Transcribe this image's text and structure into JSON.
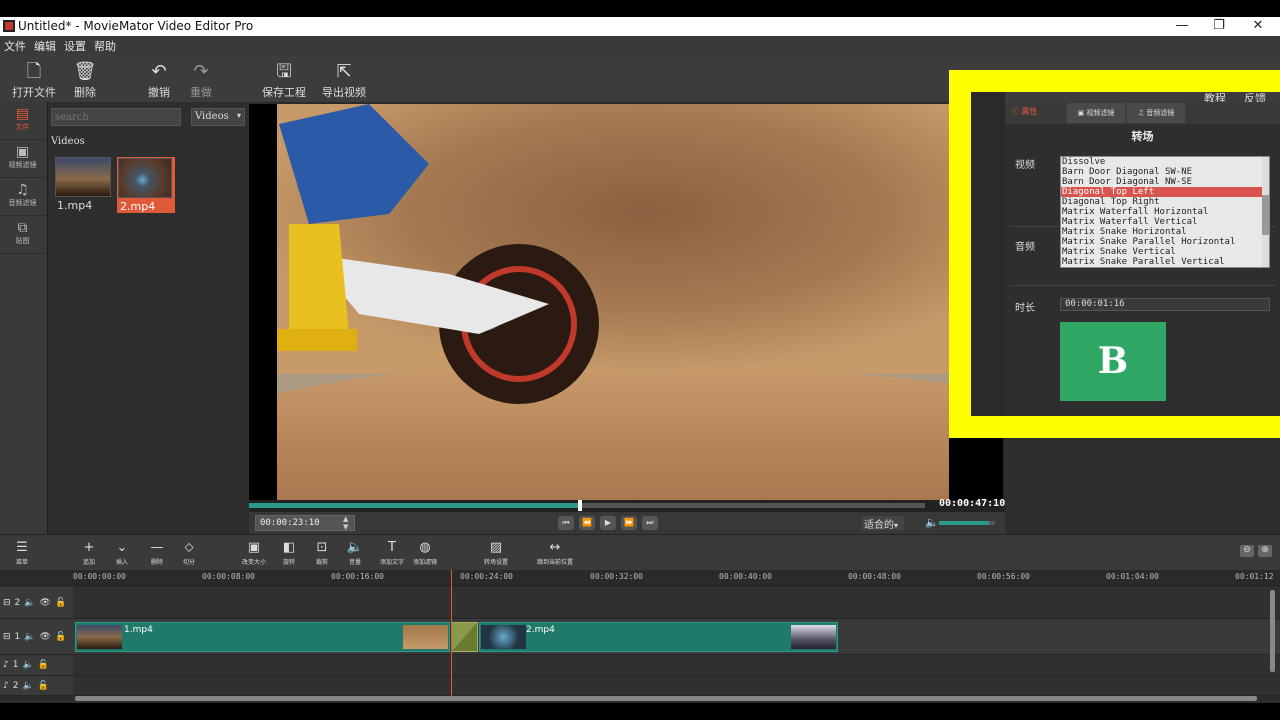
{
  "window": {
    "title": "Untitled* - MovieMator Video Editor Pro",
    "minimize": "—",
    "maximize": "❐",
    "close": "✕"
  },
  "menu": [
    "文件",
    "编辑",
    "设置",
    "帮助"
  ],
  "toolbar": {
    "open": "打开文件",
    "delete": "删除",
    "undo": "撤销",
    "redo": "重做",
    "save": "保存工程",
    "export": "导出视频",
    "tutorial": "教程",
    "feedback": "反馈"
  },
  "leftnav": [
    "文件",
    "视频滤镜",
    "音频滤镜",
    "贴图"
  ],
  "media": {
    "search_placeholder": "search",
    "filter": "Videos",
    "section": "Videos",
    "clips": [
      {
        "name": "1.mp4",
        "selected": false
      },
      {
        "name": "2.mp4",
        "selected": true
      }
    ]
  },
  "player": {
    "end_time": "00:00:47:10",
    "current_time": "00:00:23:10",
    "zoom": "适合的",
    "progress": 0.49,
    "volume": 0.9
  },
  "props": {
    "tabs": [
      "属性",
      "视频滤镜",
      "音频滤镜"
    ],
    "title": "转场",
    "video_label": "视频",
    "audio_label": "音频",
    "duration_label": "时长",
    "duration": "00:00:01:16",
    "transitions": [
      "Dissolve",
      "Barn Door Diagonal SW-NE",
      "Barn Door Diagonal NW-SE",
      "Diagonal Top Left",
      "Diagonal Top Right",
      "Matrix Waterfall Horizontal",
      "Matrix Waterfall Vertical",
      "Matrix Snake Horizontal",
      "Matrix Snake Parallel Horizontal",
      "Matrix Snake Vertical",
      "Matrix Snake Parallel Vertical"
    ],
    "selected_transition": "Diagonal Top Left",
    "preview_letter": "B"
  },
  "timeline": {
    "tools": [
      "菜单",
      "追加",
      "插入",
      "删除",
      "切分",
      "改变大小",
      "旋转",
      "裁剪",
      "音量",
      "添加文字",
      "添加滤镜",
      "转场设置",
      "跳到当前位置"
    ],
    "ruler": [
      "00:00:00:00",
      "00:00:08:00",
      "00:00:16:00",
      "00:00:24:00",
      "00:00:32:00",
      "00:00:40:00",
      "00:00:48:00",
      "00:00:56:00",
      "00:01:04:00",
      "00:01:12"
    ],
    "tracks": [
      {
        "name": "2",
        "kind": "video"
      },
      {
        "name": "1",
        "kind": "video"
      },
      {
        "name": "1",
        "kind": "audio"
      },
      {
        "name": "2",
        "kind": "audio"
      }
    ],
    "clip1": "1.mp4",
    "clip2": "2.mp4"
  },
  "colors": {
    "accent": "#e05a3a",
    "clip": "#1f7a6b",
    "highlight": "#ffff00",
    "transition": "#8a9a4a"
  }
}
